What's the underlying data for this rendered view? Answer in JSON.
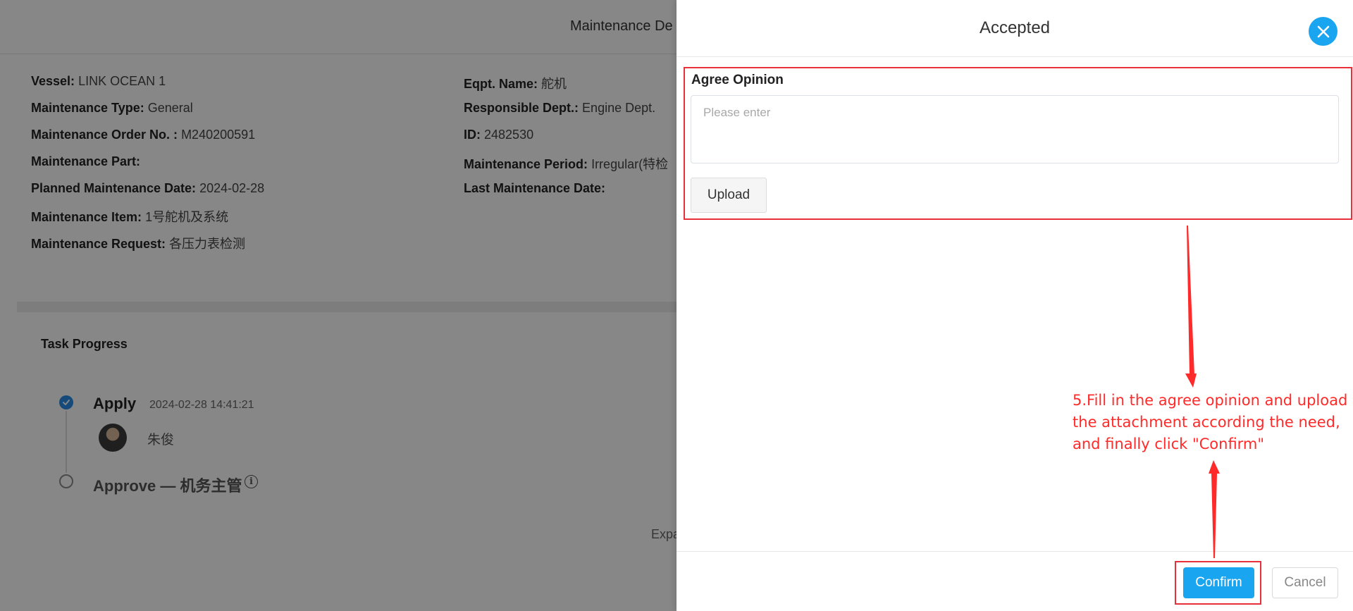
{
  "background": {
    "title": "Maintenance De",
    "left_info": [
      {
        "label": "Vessel:",
        "value": "LINK OCEAN 1"
      },
      {
        "label": "Maintenance Type:",
        "value": "General"
      },
      {
        "label": "Maintenance Order No. :",
        "value": "M240200591"
      },
      {
        "label": "Maintenance Part:",
        "value": ""
      },
      {
        "label": "Planned Maintenance Date:",
        "value": "2024-02-28"
      },
      {
        "label": "Maintenance Item:",
        "value": "1号舵机及系统"
      },
      {
        "label": "Maintenance Request:",
        "value": "各压力表检测"
      }
    ],
    "right_info": [
      {
        "label": "Eqpt. Name:",
        "value": "舵机"
      },
      {
        "label": "Responsible Dept.:",
        "value": "Engine Dept."
      },
      {
        "label": "ID:",
        "value": "2482530"
      },
      {
        "label": "Maintenance Period:",
        "value": "Irregular(特检"
      },
      {
        "label": "Last Maintenance Date:",
        "value": ""
      }
    ],
    "task_progress": {
      "title": "Task Progress",
      "apply_label": "Apply",
      "apply_time": "2024-02-28 14:41:21",
      "user_name": "朱俊",
      "approve_label": "Approve — 机务主管",
      "info_symbol": "i"
    },
    "expand_text": "Expa"
  },
  "drawer": {
    "title": "Accepted",
    "field_label": "Agree Opinion",
    "placeholder": "Please enter",
    "upload_label": "Upload",
    "confirm_label": "Confirm",
    "cancel_label": "Cancel",
    "annotation": "5.Fill in the agree opinion and upload the attachment according the need, and finally click \"Confirm\""
  },
  "colors": {
    "accent": "#1aa5f0",
    "annotation_red": "#e8303a",
    "check_blue": "#2a8ce6"
  }
}
